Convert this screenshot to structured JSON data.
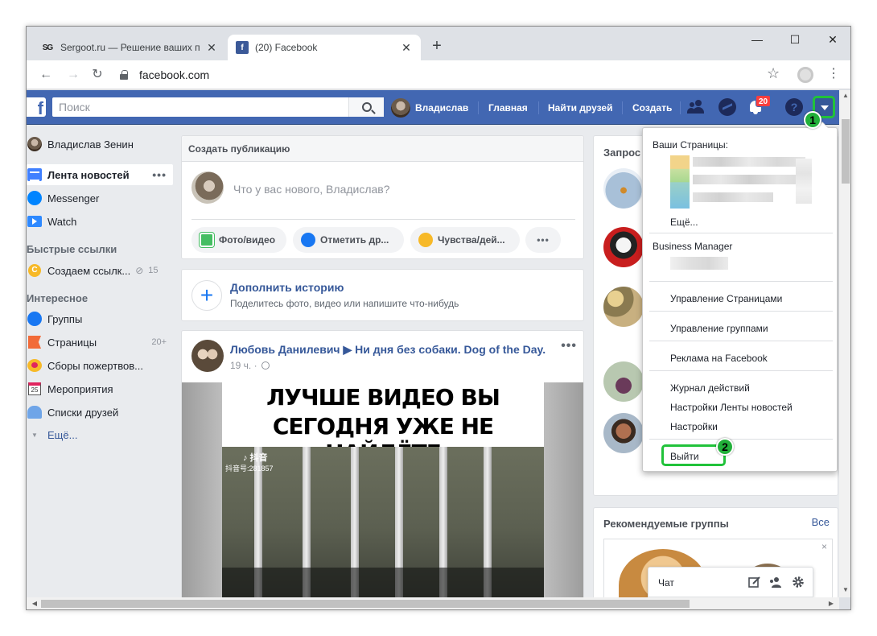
{
  "browser": {
    "tabs": [
      {
        "title": "Sergoot.ru — Решение ваших п",
        "favicon": "sg-favicon-icon",
        "close": "✕"
      },
      {
        "title": "(20) Facebook",
        "favicon": "facebook-favicon-icon",
        "close": "✕"
      }
    ],
    "new_tab": "+",
    "window_controls": {
      "minimize": "—",
      "maximize": "☐",
      "close": "✕"
    },
    "url": "facebook.com",
    "nav": {
      "back": "←",
      "forward": "→",
      "reload": "↻"
    },
    "star": "☆",
    "menu": "⋮"
  },
  "topbar": {
    "logo": "f",
    "search_placeholder": "Поиск",
    "user_name": "Владислав",
    "nav_home": "Главная",
    "nav_find_friends": "Найти друзей",
    "nav_create": "Создать",
    "notifications_count": "20",
    "help": "?",
    "accent": "#4267b2"
  },
  "markers": {
    "one": "1",
    "two": "2"
  },
  "left_sidebar": {
    "profile_name": "Владислав Зенин",
    "items": [
      {
        "label": "Лента новостей",
        "more": "•••"
      },
      {
        "label": "Messenger"
      },
      {
        "label": "Watch"
      }
    ],
    "shortcuts_header": "Быстрые ссылки",
    "shortcut": {
      "icon_letter": "C",
      "label": "Создаем ссылк...",
      "count": "15"
    },
    "explore_header": "Интересное",
    "explore": [
      {
        "label": "Группы",
        "count": ""
      },
      {
        "label": "Страницы",
        "count": "20+"
      },
      {
        "label": "Сборы пожертвов...",
        "count": ""
      },
      {
        "label": "Мероприятия",
        "count": "",
        "icon_text": "25"
      },
      {
        "label": "Списки друзей",
        "count": ""
      }
    ],
    "more": "Ещё..."
  },
  "composer": {
    "header": "Создать публикацию",
    "placeholder": "Что у вас нового, Владислав?",
    "buttons": [
      "Фото/видео",
      "Отметить др...",
      "Чувства/дей..."
    ],
    "more": "•••"
  },
  "story": {
    "plus": "+",
    "title": "Дополнить историю",
    "subtitle": "Поделитесь фото, видео или напишите что-нибудь"
  },
  "post": {
    "author": "Любовь Данилевич ▶ Ни дня без собаки. Dog of the Day.",
    "meta": "19 ч. ·",
    "more": "•••",
    "video_line1": "ЛУЧШЕ ВИДЕО ВЫ",
    "video_line2": "СЕГОДНЯ УЖЕ НЕ НАЙДЁТЕ",
    "watermark": "♪ 抖音",
    "watermark_id": "抖音号:281857"
  },
  "right_column": {
    "requests_title": "Запрос",
    "groups_title": "Рекомендуемые группы",
    "groups_all": "Все",
    "close": "×"
  },
  "dropdown": {
    "pages_header": "Ваши Страницы:",
    "more": "Ещё...",
    "business_header": "Business Manager",
    "items": [
      "Управление Страницами",
      "Управление группами",
      "Реклама на Facebook",
      "Журнал действий",
      "Настройки Ленты новостей",
      "Настройки",
      "Выйти"
    ]
  },
  "chat": {
    "label": "Чат"
  },
  "scroll": {
    "left": "◀",
    "right": "▶",
    "up": "▲",
    "down": "▼"
  }
}
